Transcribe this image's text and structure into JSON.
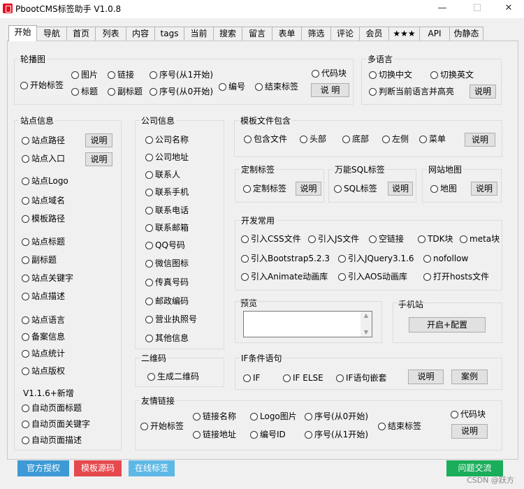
{
  "window": {
    "title": "PbootCMS标签助手 V1.0.8",
    "minimize": "—",
    "maximize": "☐",
    "close": "✕"
  },
  "tabs": [
    "开始",
    "导航",
    "首页",
    "列表",
    "内容",
    "tags",
    "当前",
    "搜索",
    "留言",
    "表单",
    "筛选",
    "评论",
    "会员",
    "★★★",
    "API",
    "伪静态"
  ],
  "carousel": {
    "title": "轮播图",
    "items": [
      "开始标签",
      "图片",
      "链接",
      "序号(从1开始)",
      "代码块",
      "标题",
      "副标题",
      "序号(从0开始)",
      "编号",
      "结束标签"
    ],
    "explain": "说 明"
  },
  "multilang": {
    "title": "多语言",
    "items": [
      "切换中文",
      "切换英文",
      "判断当前语言并高亮"
    ],
    "explain": "说明"
  },
  "site": {
    "title": "站点信息",
    "items": [
      "站点路径",
      "站点入口",
      "站点Logo",
      "站点域名",
      "模板路径",
      "站点标题",
      "副标题",
      "站点关键字",
      "站点描述",
      "站点语言",
      "备案信息",
      "站点统计",
      "站点版权"
    ],
    "explain": "说明",
    "new_label": "V1.1.6+新增",
    "new_items": [
      "自动页面标题",
      "自动页面关键字",
      "自动页面描述"
    ]
  },
  "company": {
    "title": "公司信息",
    "items": [
      "公司名称",
      "公司地址",
      "联系人",
      "联系手机",
      "联系电话",
      "联系邮箱",
      "QQ号码",
      "微信图标",
      "传真号码",
      "邮政编码",
      "营业执照号",
      "其他信息"
    ]
  },
  "qrcode": {
    "title": "二维码",
    "items": [
      "生成二维码"
    ]
  },
  "template": {
    "title": "模板文件包含",
    "items": [
      "包含文件",
      "头部",
      "底部",
      "左侧",
      "菜单"
    ],
    "explain": "说明"
  },
  "custom": {
    "title": "定制标签",
    "items": [
      "定制标签"
    ],
    "explain": "说明"
  },
  "sql": {
    "title": "万能SQL标签",
    "items": [
      "SQL标签"
    ],
    "explain": "说明"
  },
  "sitemap": {
    "title": "网站地图",
    "items": [
      "地图"
    ],
    "explain": "说明"
  },
  "dev": {
    "title": "开发常用",
    "items": [
      "引入CSS文件",
      "引入JS文件",
      "空链接",
      "TDK块",
      "meta块",
      "引入Bootstrap5.2.3",
      "引入JQuery3.1.6",
      "nofollow",
      "引入Animate动画库",
      "引入AOS动画库",
      "打开hosts文件"
    ]
  },
  "preview": {
    "title": "预览",
    "value": ""
  },
  "mobile": {
    "title": "手机站",
    "button": "开启+配置"
  },
  "ifcond": {
    "title": "IF条件语句",
    "items": [
      "IF",
      "IF ELSE",
      "IF语句嵌套"
    ],
    "explain": "说明",
    "example": "案例"
  },
  "links": {
    "title": "友情链接",
    "items": [
      "开始标签",
      "链接名称",
      "Logo图片",
      "序号(从0开始)",
      "结束标签",
      "代码块",
      "链接地址",
      "编号ID",
      "序号(从1开始)"
    ],
    "explain": "说明"
  },
  "footer": {
    "buttons": [
      "官方授权",
      "模板源码",
      "在线标签",
      "问题交流"
    ],
    "watermark": "CSDN @跃方"
  },
  "colors": {
    "auth": "#3d9ad6",
    "source": "#e5484d",
    "online": "#5db8e6",
    "community": "#1aad5a"
  }
}
